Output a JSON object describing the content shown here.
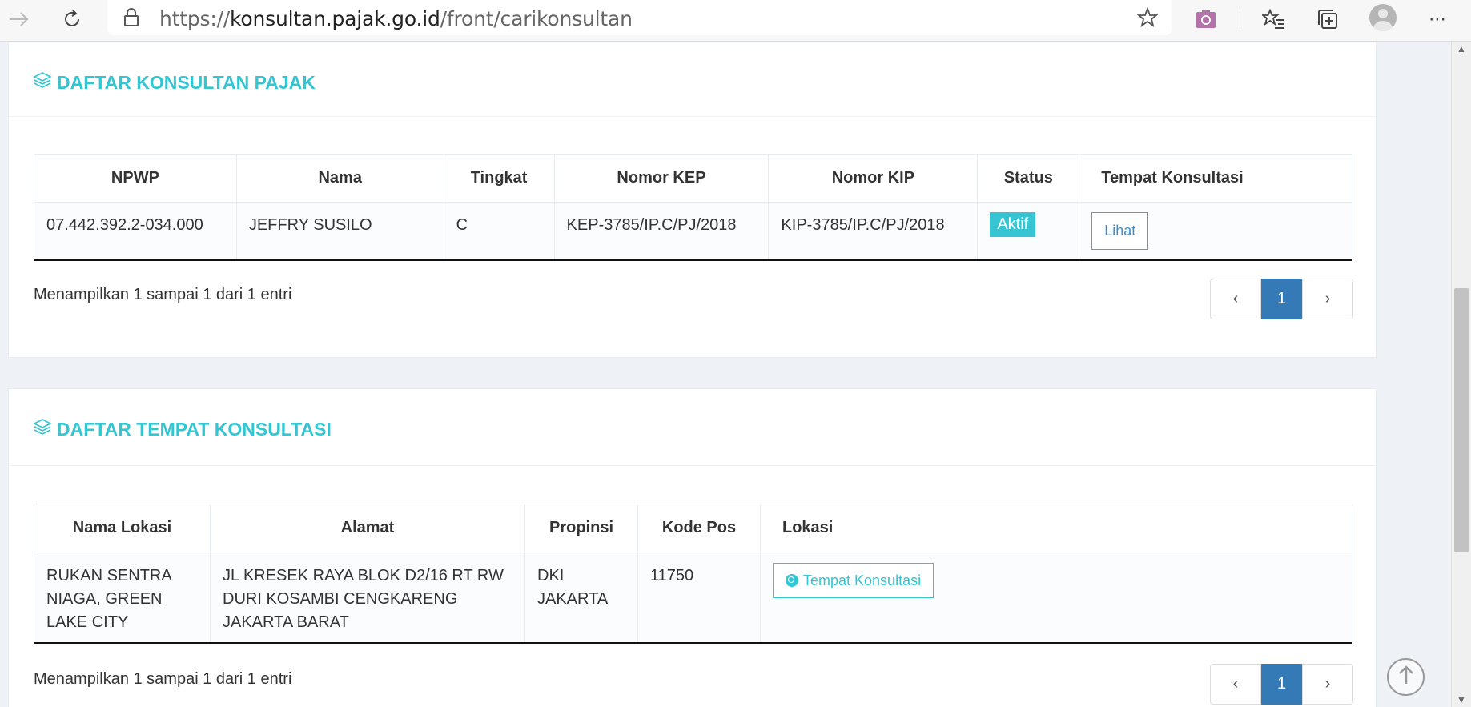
{
  "browser": {
    "url_proto": "https://",
    "url_host": "konsultan.pajak.go.id",
    "url_path": "/front/carikonsultan"
  },
  "konsultan": {
    "title": "DAFTAR KONSULTAN PAJAK",
    "headers": [
      "NPWP",
      "Nama",
      "Tingkat",
      "Nomor KEP",
      "Nomor KIP",
      "Status",
      "Tempat Konsultasi"
    ],
    "row": {
      "npwp": "07.442.392.2-034.000",
      "nama": "JEFFRY SUSILO",
      "tingkat": "C",
      "kep": "KEP-3785/IP.C/PJ/2018",
      "kip": "KIP-3785/IP.C/PJ/2018",
      "status": "Aktif",
      "action": "Lihat"
    },
    "info": "Menampilkan 1 sampai 1 dari 1 entri",
    "pagination": {
      "prev": "‹",
      "current": "1",
      "next": "›"
    }
  },
  "tempat": {
    "title": "DAFTAR TEMPAT KONSULTASI",
    "headers": [
      "Nama Lokasi",
      "Alamat",
      "Propinsi",
      "Kode Pos",
      "Lokasi"
    ],
    "row": {
      "nama_lokasi": "RUKAN SENTRA NIAGA, GREEN LAKE CITY",
      "alamat": "JL KRESEK RAYA BLOK D2/16 RT RW DURI KOSAMBI CENGKARENG JAKARTA BARAT",
      "propinsi": "DKI JAKARTA",
      "kode_pos": "11750",
      "action": "Tempat Konsultasi"
    },
    "info": "Menampilkan 1 sampai 1 dari 1 entri",
    "pagination": {
      "prev": "‹",
      "current": "1",
      "next": "›"
    }
  },
  "icons": [
    "forward-icon",
    "refresh-icon",
    "lock-icon",
    "favorite-star-icon",
    "screenshot-icon",
    "favorites-list-icon",
    "collections-icon",
    "profile-icon",
    "more-icon",
    "layers-icon",
    "globe-icon",
    "arrow-up-icon"
  ],
  "colors": {
    "accent": "#32c5d2",
    "pagination_active": "#337ab7",
    "button_border": "#5a9bcd"
  }
}
